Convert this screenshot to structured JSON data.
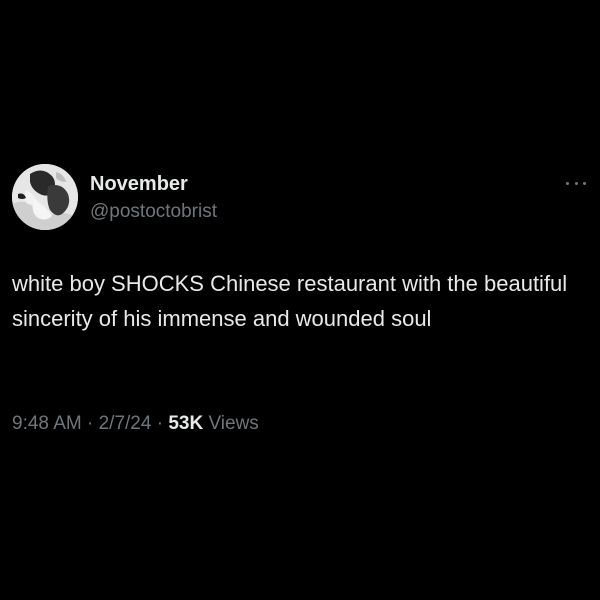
{
  "author": {
    "display_name": "November",
    "handle": "@postoctobrist"
  },
  "tweet": {
    "text": "white boy SHOCKS Chinese restaurant with the beautiful sincerity of his immense and wounded soul"
  },
  "meta": {
    "time": "9:48 AM",
    "separator": "·",
    "date": "2/7/24",
    "views_count": "53K",
    "views_label": "Views"
  },
  "icons": {
    "more": "more-options-icon",
    "avatar": "profile-avatar"
  },
  "colors": {
    "background": "#000000",
    "primary_text": "#e7e9ea",
    "secondary_text": "#71767b"
  }
}
